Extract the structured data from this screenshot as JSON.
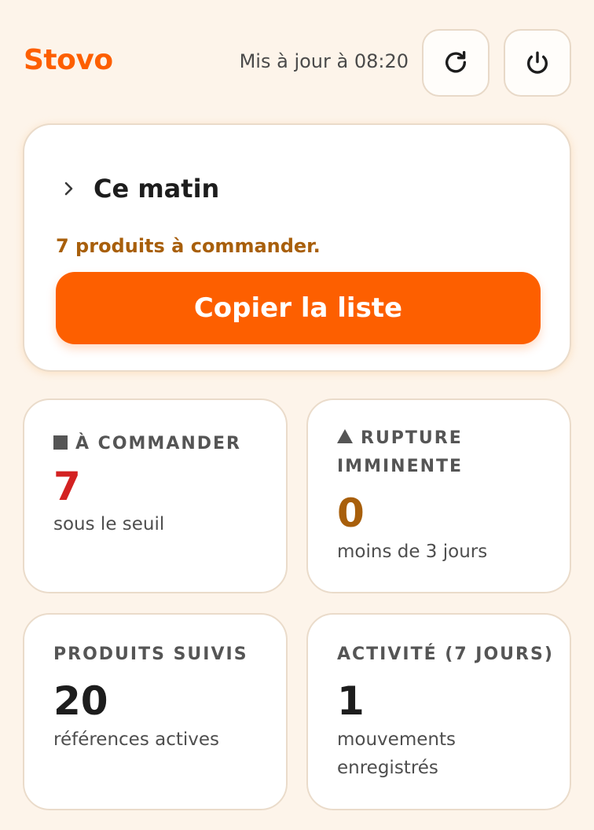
{
  "header": {
    "logo": "Stovo",
    "updated": "Mis à jour à 08:20",
    "refresh_icon": "refresh-icon",
    "power_icon": "power-icon"
  },
  "hero": {
    "title": "Ce matin",
    "subtitle": "7 produits à commander.",
    "button_label": "Copier la liste",
    "chevron_icon": "chevron-right-icon"
  },
  "cards": [
    {
      "icon": "square-icon",
      "label": "À COMMANDER",
      "value": "7",
      "value_color": "#d32222",
      "description": "sous le seuil"
    },
    {
      "icon": "warning-triangle-icon",
      "label": "RUPTURE IMMINENTE",
      "value": "0",
      "value_color": "#a85f0b",
      "description": "moins de 3 jours"
    },
    {
      "label": "PRODUITS SUIVIS",
      "value": "20",
      "value_color": "#1d1d1d",
      "description": "références actives"
    },
    {
      "label": "ACTIVITÉ (7 JOURS)",
      "value": "1",
      "value_color": "#1d1d1d",
      "description": "mouvements enregistrés"
    }
  ],
  "colors": {
    "brand": "#fd5f00",
    "background": "#fdf4ea",
    "warning_text": "#a85f0b",
    "danger": "#d32222"
  }
}
